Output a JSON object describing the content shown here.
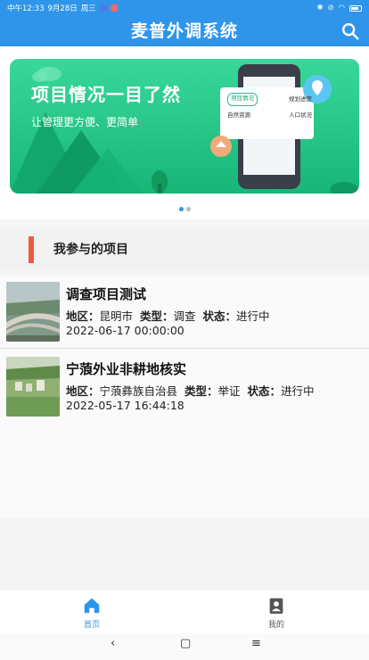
{
  "status_bar": {
    "time": "中午12:33",
    "date": "9月28日",
    "weekday": "周三",
    "battery": "51"
  },
  "appbar": {
    "title": "麦普外调系统",
    "search_icon": "search-icon"
  },
  "banner": {
    "headline": "项目情况一目了然",
    "subline": "让管理更方便、更简单",
    "card_items": [
      "项目情况",
      "规划进度",
      "自然资源",
      "人口状况"
    ],
    "dots": 2,
    "active_dot": 0
  },
  "section": {
    "title": "我参与的项目"
  },
  "projects": [
    {
      "name": "调查项目测试",
      "region_label": "地区：",
      "region": "昆明市",
      "type_label": "类型：",
      "type": "调查",
      "status_label": "状态：",
      "status": "进行中",
      "time": "2022-06-17 00:00:00"
    },
    {
      "name": "宁蒗外业非耕地核实",
      "region_label": "地区：",
      "region": "宁蒗彝族自治县",
      "type_label": "类型：",
      "type": "举证",
      "status_label": "状态：",
      "status": "进行中",
      "time": "2022-05-17 16:44:18"
    }
  ],
  "tabs": [
    {
      "label": "首页",
      "icon": "home-icon",
      "active": true
    },
    {
      "label": "我的",
      "icon": "profile-icon",
      "active": false
    }
  ],
  "colors": {
    "primary": "#2f95ea",
    "accent": "#f05a3c",
    "banner_green": "#1fc184"
  }
}
